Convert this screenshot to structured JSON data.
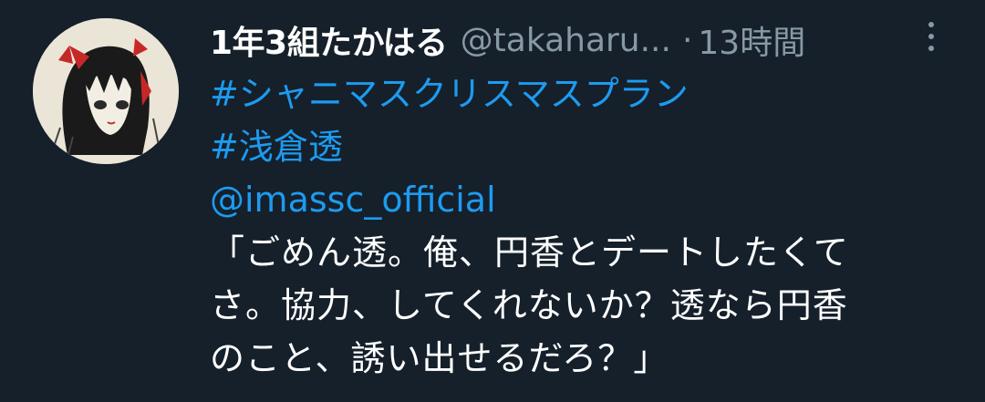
{
  "tweet": {
    "display_name": "1年3組たかはる",
    "handle": "@takaharu...",
    "separator": "·",
    "time": "13時間",
    "hashtags": [
      "#シャニマスクリスマスプラン",
      "#浅倉透"
    ],
    "mention": "@imassc_official",
    "text_lines": [
      "「ごめん透。俺、円香とデートしたくて",
      "さ。協力、してくれないか？透なら円香",
      "のこと、誘い出せるだろ？」"
    ]
  },
  "colors": {
    "background": "#15202b",
    "link": "#1d9bf0",
    "muted": "#8899a6",
    "text": "#ffffff"
  },
  "icons": {
    "more": "more-vertical-icon"
  }
}
